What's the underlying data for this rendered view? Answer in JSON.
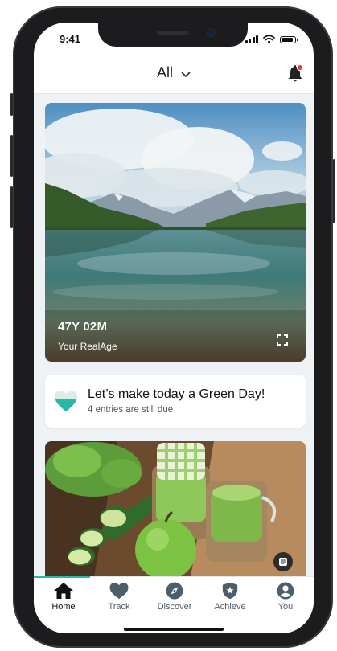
{
  "status_bar": {
    "time": "9:41"
  },
  "header": {
    "filter_label": "All"
  },
  "realage_card": {
    "value": "47Y 02M",
    "label": "Your RealAge"
  },
  "green_day_card": {
    "title": "Let’s make today a Green Day!",
    "subtitle": "4 entries are still due"
  },
  "tabs": [
    {
      "label": "Home",
      "icon": "home-icon",
      "active": true
    },
    {
      "label": "Track",
      "icon": "heart-icon"
    },
    {
      "label": "Discover",
      "icon": "compass-icon"
    },
    {
      "label": "Achieve",
      "icon": "shield-star-icon"
    },
    {
      "label": "You",
      "icon": "person-icon"
    }
  ],
  "colors": {
    "accent": "#29b8a5",
    "notification": "#e8374a",
    "icon_gray": "#4d5e6b"
  }
}
